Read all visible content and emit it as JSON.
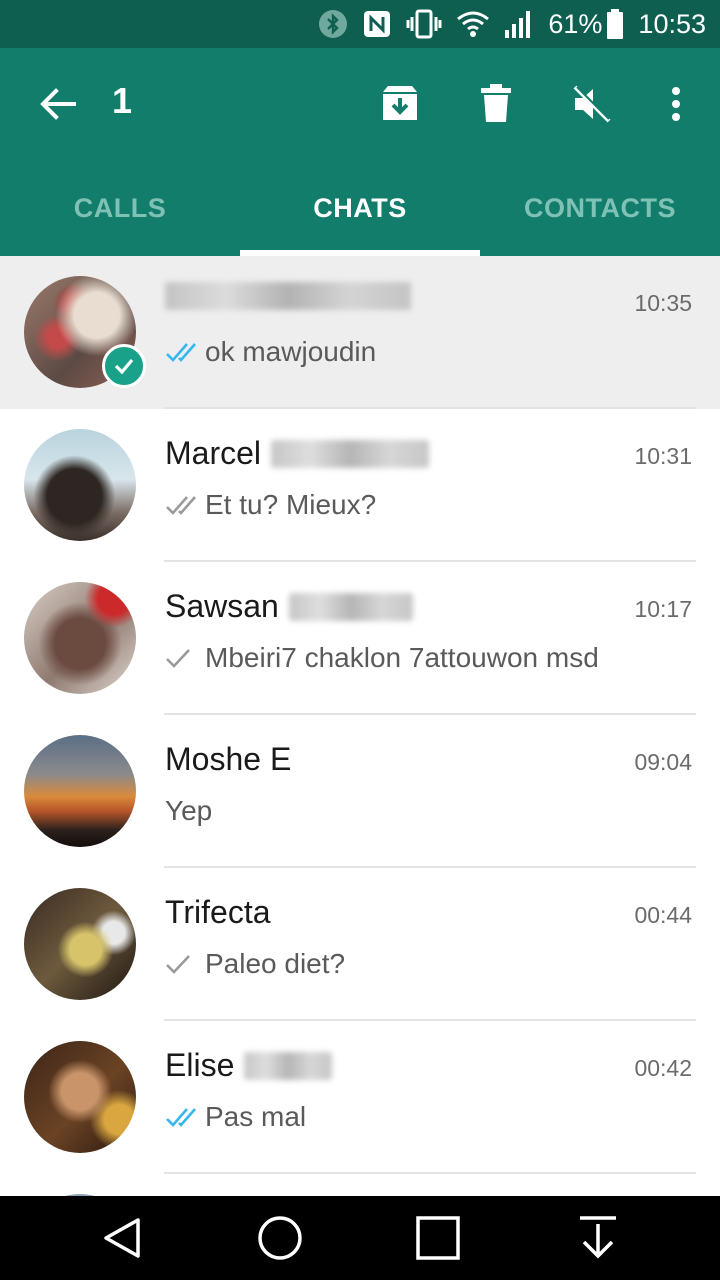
{
  "status_bar": {
    "battery_percent": "61%",
    "time": "10:53",
    "icons": [
      "bluetooth-icon",
      "nfc-icon",
      "vibrate-icon",
      "wifi-icon",
      "signal-icon",
      "battery-icon"
    ]
  },
  "app_bar": {
    "selected_count": "1",
    "actions": [
      "archive-icon",
      "delete-icon",
      "mute-icon",
      "more-icon"
    ]
  },
  "tabs": [
    {
      "label": "CALLS",
      "active": false
    },
    {
      "label": "CHATS",
      "active": true
    },
    {
      "label": "CONTACTS",
      "active": false
    }
  ],
  "chats": [
    {
      "name": "",
      "time": "10:35",
      "message": "ok mawjoudin",
      "ticks": "double-blue",
      "selected": true
    },
    {
      "name": "Marcel",
      "time": "10:31",
      "message": "Et tu? Mieux?",
      "ticks": "double-grey",
      "selected": false
    },
    {
      "name": "Sawsan",
      "time": "10:17",
      "message": "Mbeiri7 chaklon 7attouwon msd",
      "ticks": "single-grey",
      "selected": false
    },
    {
      "name": "Moshe E",
      "time": "09:04",
      "message": "Yep",
      "ticks": "none",
      "selected": false
    },
    {
      "name": "Trifecta",
      "time": "00:44",
      "message": "Paleo diet?",
      "ticks": "single-grey",
      "selected": false
    },
    {
      "name": "Elise",
      "time": "00:42",
      "message": "Pas mal",
      "ticks": "double-blue",
      "selected": false
    }
  ],
  "colors": {
    "status_bar": "#0f5f51",
    "app_bar": "#137d6b",
    "tab_inactive": "#7fc1b5",
    "read_tick": "#34b7f1",
    "badge": "#1aa18a"
  },
  "nav_bar": [
    "back-nav-icon",
    "home-nav-icon",
    "recents-nav-icon",
    "notification-pull-icon"
  ]
}
